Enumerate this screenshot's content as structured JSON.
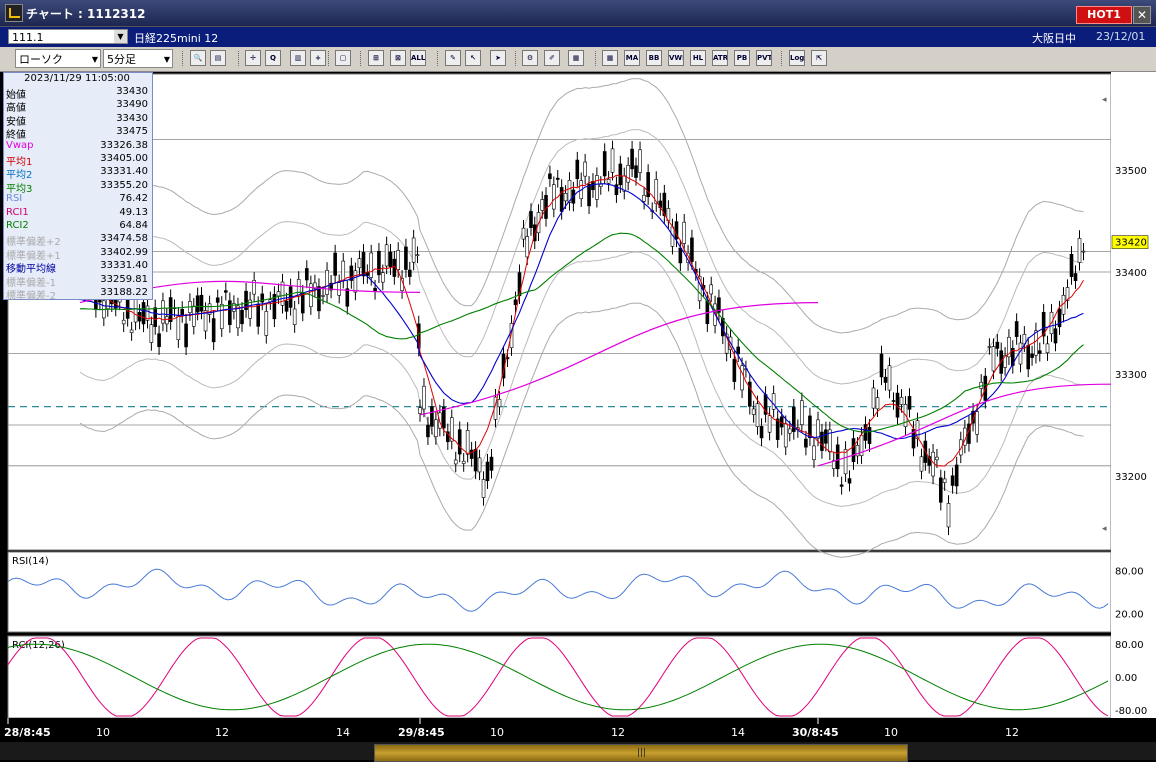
{
  "window": {
    "title": "チャート : 1112312",
    "hot_badge": "HOT1",
    "close_label": "✕"
  },
  "symbol_bar": {
    "code": "111.1",
    "instrument": "日経225mini 12",
    "market": "大阪日中",
    "date": "23/12/01"
  },
  "toolbar": {
    "chart_type": "ローソク",
    "interval": "5分足",
    "buttons": [
      {
        "name": "zoom-icon",
        "text": "🔍"
      },
      {
        "name": "bars-icon",
        "text": "▤"
      },
      {
        "name": "cross-icon",
        "text": "✛"
      },
      {
        "name": "q-icon",
        "text": "Q"
      },
      {
        "name": "chart-icon",
        "text": "▥"
      },
      {
        "name": "plus-icon",
        "text": "+"
      },
      {
        "name": "gray-icon",
        "text": "▢"
      },
      {
        "name": "candle-icon",
        "text": "⊞"
      },
      {
        "name": "candle2-icon",
        "text": "⊠"
      },
      {
        "name": "all-icon",
        "text": "ALL"
      },
      {
        "name": "pen-icon",
        "text": "✎"
      },
      {
        "name": "cursor-icon",
        "text": "↖"
      },
      {
        "name": "arrow-icon",
        "text": "➤"
      },
      {
        "name": "gear-icon",
        "text": "⚙"
      },
      {
        "name": "brush-icon",
        "text": "✐"
      },
      {
        "name": "palette-icon",
        "text": "▦"
      },
      {
        "name": "grid-icon",
        "text": "▦"
      },
      {
        "name": "ma-icon",
        "text": "MA"
      },
      {
        "name": "bb-icon",
        "text": "BB"
      },
      {
        "name": "vwe-icon",
        "text": "VWE"
      },
      {
        "name": "hl-icon",
        "text": "HL"
      },
      {
        "name": "atr-icon",
        "text": "ATR"
      },
      {
        "name": "pb-icon",
        "text": "PB"
      },
      {
        "name": "pvt-icon",
        "text": "PVT"
      },
      {
        "name": "log-icon",
        "text": "Log"
      },
      {
        "name": "export-icon",
        "text": "⇱"
      }
    ]
  },
  "info_panel": {
    "datetime": "2023/11/29  11:05:00",
    "rows": [
      {
        "k": "始値",
        "v": "33430",
        "color": "#000"
      },
      {
        "k": "高値",
        "v": "33490",
        "color": "#000"
      },
      {
        "k": "安値",
        "v": "33430",
        "color": "#000"
      },
      {
        "k": "終値",
        "v": "33475",
        "color": "#000"
      },
      {
        "k": "Vwap",
        "v": "33326.38",
        "color": "#e000e0"
      },
      {
        "k": "平均1",
        "v": "33405.00",
        "color": "#d00000"
      },
      {
        "k": "平均2",
        "v": "33331.40",
        "color": "#0070c0"
      },
      {
        "k": "平均3",
        "v": "33355.20",
        "color": "#008000"
      },
      {
        "k": "RSI",
        "v": "76.42",
        "color": "#6a8ad8"
      },
      {
        "k": "RCI1",
        "v": "49.13",
        "color": "#d00070"
      },
      {
        "k": "RCI2",
        "v": "64.84",
        "color": "#008000"
      },
      {
        "k": "標準偏差+2",
        "v": "33474.58",
        "color": "#aaaaaa"
      },
      {
        "k": "標準偏差+1",
        "v": "33402.99",
        "color": "#aaaaaa"
      },
      {
        "k": "移動平均線",
        "v": "33331.40",
        "color": "#0000a0"
      },
      {
        "k": "標準偏差-1",
        "v": "33259.81",
        "color": "#aaaaaa"
      },
      {
        "k": "標準偏差-2",
        "v": "33188.22",
        "color": "#aaaaaa"
      }
    ]
  },
  "chart_data": {
    "type": "line",
    "price_axis": {
      "ticks": [
        "33500",
        "33400",
        "33300",
        "33200"
      ],
      "current_price": "33420"
    },
    "x_labels": [
      "28/8:45",
      "10",
      "12",
      "14",
      "29/8:45",
      "10",
      "12",
      "14",
      "30/8:45",
      "10",
      "12"
    ],
    "rsi_panel": {
      "title": "RSI(14)",
      "ticks": [
        "80.00",
        "20.00"
      ]
    },
    "rci_panel": {
      "title": "RCI(12,26)",
      "ticks": [
        "80.00",
        "0.00",
        "-80.00"
      ]
    },
    "series": [
      {
        "name": "平均1",
        "color": "#e00000"
      },
      {
        "name": "平均2",
        "color": "#0000d0"
      },
      {
        "name": "平均3",
        "color": "#008000"
      },
      {
        "name": "Vwap",
        "color": "#e000e0"
      }
    ],
    "close_keypoints": [
      {
        "date": "11/28",
        "time": "08:45",
        "close": 33390
      },
      {
        "date": "11/28",
        "time": "10:00",
        "close": 33350
      },
      {
        "date": "11/28",
        "time": "11:00",
        "close": 33360
      },
      {
        "date": "11/28",
        "time": "12:30",
        "close": 33370
      },
      {
        "date": "11/28",
        "time": "14:00",
        "close": 33400
      },
      {
        "date": "11/28",
        "time": "15:00",
        "close": 33410
      },
      {
        "date": "11/29",
        "time": "08:45",
        "close": 33270
      },
      {
        "date": "11/29",
        "time": "10:00",
        "close": 33200
      },
      {
        "date": "11/29",
        "time": "10:40",
        "close": 33420
      },
      {
        "date": "11/29",
        "time": "11:05",
        "close": 33475
      },
      {
        "date": "11/29",
        "time": "12:45",
        "close": 33500
      },
      {
        "date": "11/29",
        "time": "13:30",
        "close": 33440
      },
      {
        "date": "11/29",
        "time": "14:30",
        "close": 33330
      },
      {
        "date": "11/29",
        "time": "15:00",
        "close": 33260
      },
      {
        "date": "11/30",
        "time": "08:45",
        "close": 33240
      },
      {
        "date": "11/30",
        "time": "09:20",
        "close": 33200
      },
      {
        "date": "11/30",
        "time": "10:00",
        "close": 33300
      },
      {
        "date": "11/30",
        "time": "10:40",
        "close": 33230
      },
      {
        "date": "11/30",
        "time": "11:10",
        "close": 33180
      },
      {
        "date": "11/30",
        "time": "12:00",
        "close": 33320
      },
      {
        "date": "11/30",
        "time": "13:00",
        "close": 33330
      },
      {
        "date": "11/30",
        "time": "13:40",
        "close": 33420
      }
    ]
  }
}
